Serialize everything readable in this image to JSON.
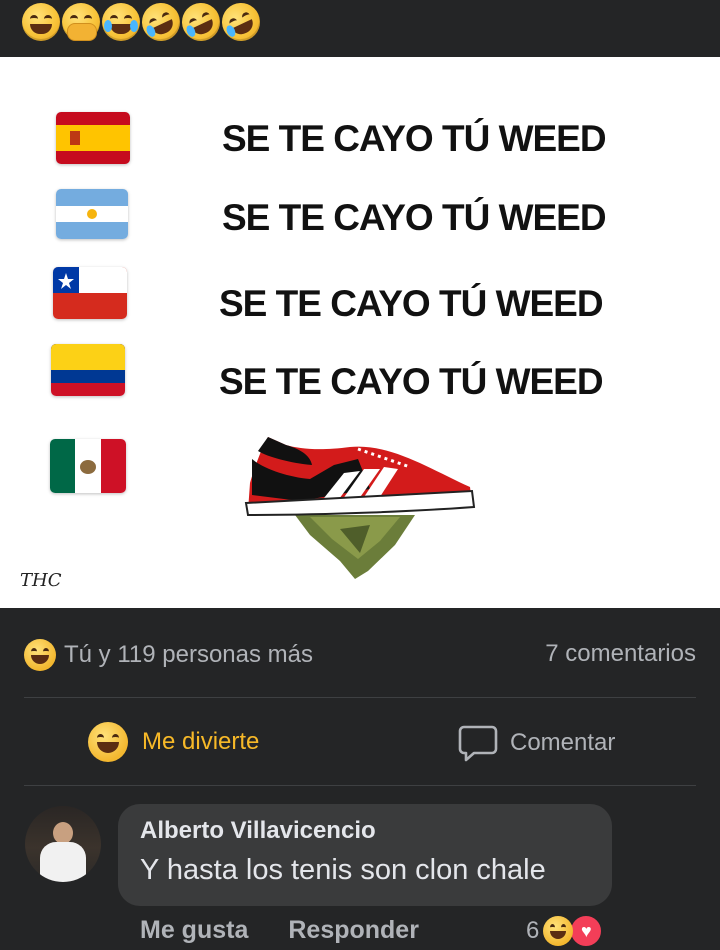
{
  "header": {
    "emojis": [
      "grinning-squinting-face",
      "face-with-hand-over-mouth",
      "tears-of-joy",
      "rolling-on-floor-laughing",
      "rolling-on-floor-laughing",
      "rolling-on-floor-laughing"
    ]
  },
  "meme": {
    "rows": [
      {
        "flag": "spain-flag",
        "text": "SE TE CAYO TÚ WEED"
      },
      {
        "flag": "argentina-flag",
        "text": "SE TE CAYO TÚ WEED"
      },
      {
        "flag": "chile-flag",
        "text": "SE TE CAYO TÚ WEED"
      },
      {
        "flag": "colombia-flag",
        "text": "SE TE CAYO TÚ WEED"
      },
      {
        "flag": "mexico-flag",
        "text": ""
      }
    ],
    "signature": "THC"
  },
  "stats": {
    "reactions_text": "Tú y 119 personas más",
    "comments_text": "7 comentarios"
  },
  "actions": {
    "react_label": "Me divierte",
    "comment_label": "Comentar"
  },
  "comment": {
    "author": "Alberto Villavicencio",
    "text": "Y hasta los tenis son clon chale",
    "like_label": "Me gusta",
    "reply_label": "Responder",
    "reaction_count": "6"
  },
  "colors": {
    "background": "#242526",
    "accent_orange": "#f7b928",
    "muted_text": "#b0b3b8",
    "bubble": "#3a3b3c",
    "heart": "#f33e58"
  }
}
